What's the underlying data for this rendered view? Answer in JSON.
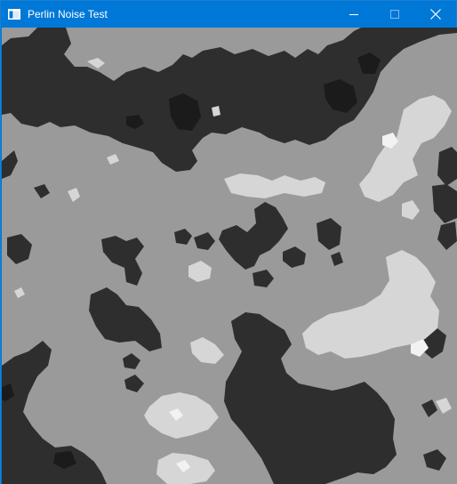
{
  "window": {
    "title": "Perlin Noise Test",
    "icon": "window-app-icon",
    "controls": {
      "minimize": "minimize-icon",
      "maximize": "maximize-icon",
      "close": "close-icon"
    }
  },
  "noise_colors": {
    "dark": "#2e2e2e",
    "darkest": "#1b1b1b",
    "mid": "#9a9a9a",
    "light": "#d6d6d6",
    "lightest": "#f2f2f2"
  },
  "theme": {
    "titlebar": "#0078d7",
    "title_text": "#ffffff"
  }
}
